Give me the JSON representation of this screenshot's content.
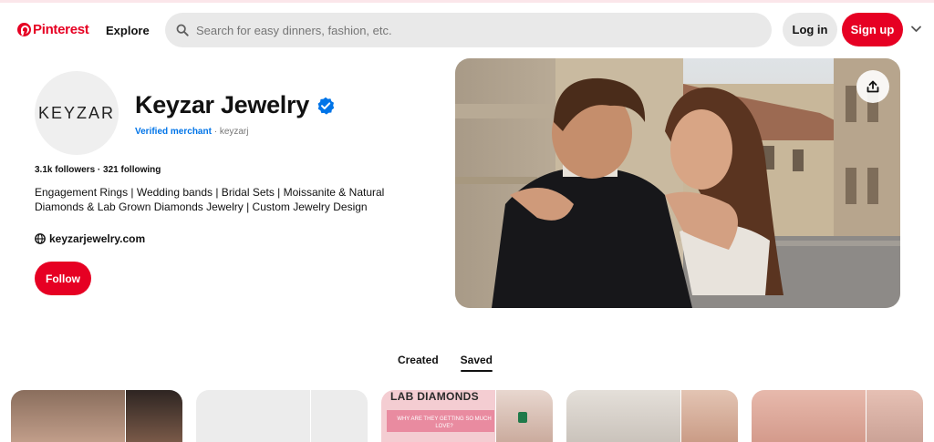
{
  "header": {
    "logo_text": "Pinterest",
    "explore_label": "Explore",
    "search_placeholder": "Search for easy dinners, fashion, etc.",
    "login_label": "Log in",
    "signup_label": "Sign up"
  },
  "profile": {
    "avatar_text": "KEYZAR",
    "name": "Keyzar Jewelry",
    "verified_label": "Verified merchant",
    "handle_sep": " · ",
    "handle": "keyzarj",
    "stats": "3.1k followers · 321 following",
    "bio": "Engagement Rings | Wedding bands | Bridal Sets | Moissanite & Natural Diamonds & Lab Grown Diamonds Jewelry | Custom Jewelry Design",
    "website": "keyzarjewelry.com",
    "follow_label": "Follow"
  },
  "tabs": {
    "created": "Created",
    "saved": "Saved",
    "active": "Saved"
  },
  "boards": {
    "third_title": "LAB DIAMONDS",
    "third_subtitle": "WHY ARE THEY GETTING SO MUCH LOVE?"
  },
  "colors": {
    "brand": "#e60023",
    "verified": "#0074e8",
    "search_bg": "#e9e9e9"
  },
  "icons": [
    "pinterest-logo-icon",
    "search-icon",
    "chevron-down-icon",
    "verified-check-icon",
    "globe-icon",
    "share-icon"
  ]
}
